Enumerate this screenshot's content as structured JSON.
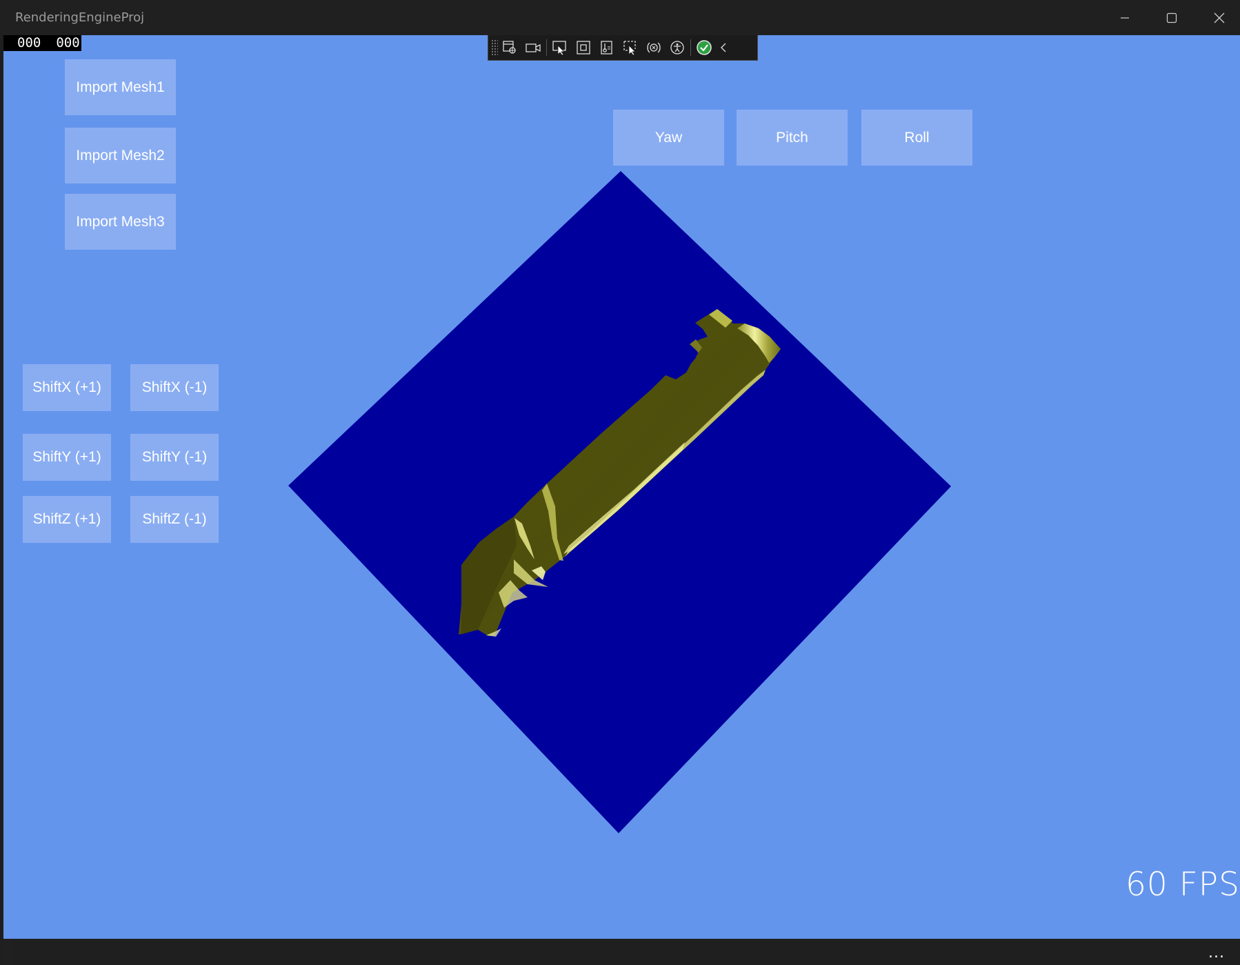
{
  "window": {
    "title": "RenderingEngineProj"
  },
  "frame_counter": {
    "left": "000",
    "right": "000"
  },
  "dev_toolbar": {
    "icons": [
      "live-visual-tree-icon",
      "camera-icon",
      "select-element-icon",
      "display-layout-adorners-icon",
      "track-focus-icon",
      "hot-reload-icon",
      "binding-failures-icon",
      "accessibility-icon",
      "status-ok-icon",
      "collapse-chevron-icon"
    ]
  },
  "import_buttons": [
    {
      "label": "Import Mesh1"
    },
    {
      "label": "Import Mesh2"
    },
    {
      "label": "Import Mesh3"
    }
  ],
  "rotation_buttons": [
    {
      "label": "Yaw"
    },
    {
      "label": "Pitch"
    },
    {
      "label": "Roll"
    }
  ],
  "shift_buttons": [
    {
      "label": "ShiftX (+1)"
    },
    {
      "label": "ShiftX (-1)"
    },
    {
      "label": "ShiftY (+1)"
    },
    {
      "label": "ShiftY (-1)"
    },
    {
      "label": "ShiftZ (+1)"
    },
    {
      "label": "ShiftZ (-1)"
    }
  ],
  "fps_label": "60 FPS",
  "app_bar": {
    "more_label": "..."
  },
  "colors": {
    "background": "#6495ed",
    "button": "#8aadf2",
    "plane": "#00009c",
    "mesh": "#4f4f0e",
    "mesh_highlight": "#e6e67a",
    "status_ok": "#2ea043"
  }
}
